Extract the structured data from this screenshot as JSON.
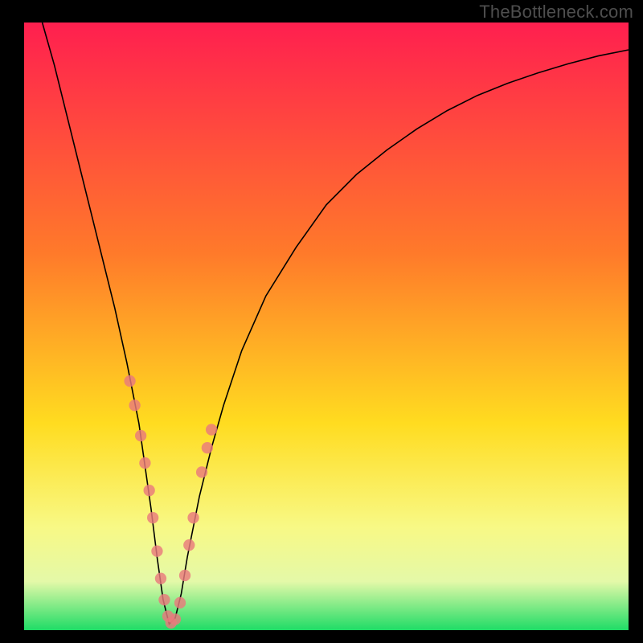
{
  "watermark": "TheBottleneck.com",
  "colors": {
    "gradient_top": "#ff1f4f",
    "gradient_mid1": "#ff7a2a",
    "gradient_mid2": "#ffdc20",
    "gradient_mid3": "#f8f985",
    "gradient_mid4": "#e4f9a8",
    "gradient_bottom": "#1fdc66",
    "curve": "#000000",
    "dots": "#e97a7d",
    "frame": "#000000"
  },
  "chart_data": {
    "type": "line",
    "title": "",
    "xlabel": "",
    "ylabel": "",
    "xlim": [
      0,
      100
    ],
    "ylim": [
      0,
      100
    ],
    "x_min_vertex": 24,
    "curve": {
      "name": "bottleneck-v-curve",
      "x": [
        3,
        5,
        7,
        9,
        11,
        13,
        15,
        17,
        19,
        21,
        22,
        23,
        24,
        25,
        26,
        27,
        29,
        31,
        33,
        36,
        40,
        45,
        50,
        55,
        60,
        65,
        70,
        75,
        80,
        85,
        90,
        95,
        100
      ],
      "y": [
        100,
        93,
        85,
        77,
        69,
        61,
        53,
        44,
        34,
        20,
        12,
        5,
        1,
        2,
        6,
        12,
        22,
        30,
        37,
        46,
        55,
        63,
        70,
        75,
        79,
        82.5,
        85.5,
        88,
        90,
        91.7,
        93.2,
        94.5,
        95.5
      ]
    },
    "series": [
      {
        "name": "sample-dots",
        "x": [
          17.5,
          18.3,
          19.3,
          20.0,
          20.7,
          21.3,
          22.0,
          22.6,
          23.2,
          23.8,
          24.3,
          25.0,
          25.8,
          26.6,
          27.3,
          28.0,
          29.4,
          30.3,
          31.0
        ],
        "y": [
          41,
          37,
          32,
          27.5,
          23,
          18.5,
          13,
          8.5,
          5,
          2.3,
          1.2,
          1.8,
          4.5,
          9,
          14,
          18.5,
          26,
          30,
          33
        ]
      }
    ],
    "annotations": []
  }
}
